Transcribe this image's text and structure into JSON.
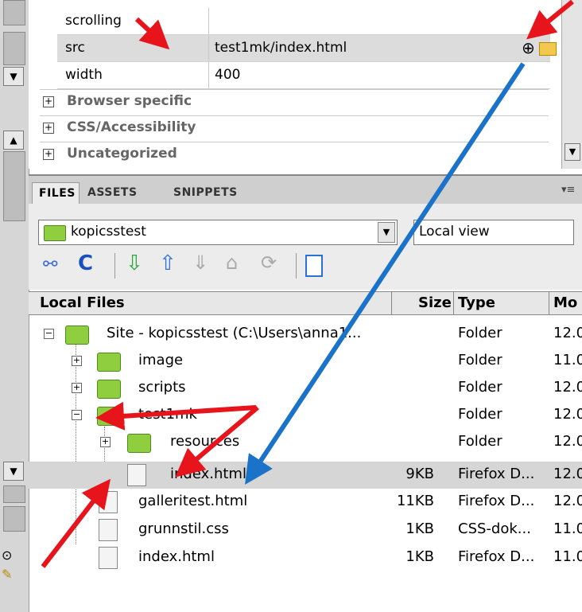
{
  "properties": {
    "rows": [
      {
        "key": "scrolling",
        "value": ""
      },
      {
        "key": "src",
        "value": "test1mk/index.html"
      },
      {
        "key": "width",
        "value": "400"
      }
    ],
    "groups": [
      "Browser specific",
      "CSS/Accessibility",
      "Uncategorized"
    ]
  },
  "tabs": [
    "FILES",
    "ASSETS",
    "SNIPPETS"
  ],
  "site_select": "kopicsstest",
  "view_select": "Local view",
  "columns": {
    "name": "Local Files",
    "size": "Size",
    "type": "Type",
    "modified": "Mo"
  },
  "files": [
    {
      "name": "Site - kopicsstest (C:\\Users\\anna1...",
      "size": "",
      "type": "Folder",
      "modified": "12.0"
    },
    {
      "name": "image",
      "size": "",
      "type": "Folder",
      "modified": "11.0"
    },
    {
      "name": "scripts",
      "size": "",
      "type": "Folder",
      "modified": "12.0"
    },
    {
      "name": "test1mk",
      "size": "",
      "type": "Folder",
      "modified": "12.0"
    },
    {
      "name": "resources",
      "size": "",
      "type": "Folder",
      "modified": "12.0"
    },
    {
      "name": "index.html",
      "size": "9KB",
      "type": "Firefox D...",
      "modified": "12.0"
    },
    {
      "name": "galleritest.html",
      "size": "11KB",
      "type": "Firefox D...",
      "modified": "12.0"
    },
    {
      "name": "grunnstil.css",
      "size": "1KB",
      "type": "CSS-dok...",
      "modified": "11.0"
    },
    {
      "name": "index.html",
      "size": "1KB",
      "type": "Firefox D...",
      "modified": "11.0"
    }
  ],
  "colors": {
    "annotation_red": "#e8141c",
    "annotation_blue": "#1a73c8",
    "selected_row": "#d6d6d6",
    "folder_green": "#8fcf3f"
  }
}
